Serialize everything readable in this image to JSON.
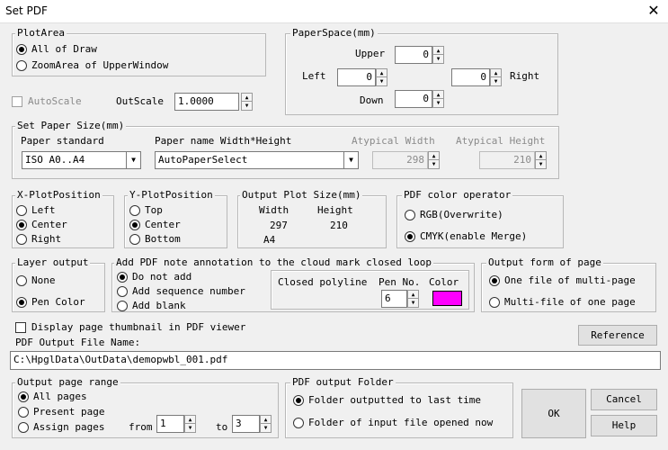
{
  "window": {
    "title": "Set PDF",
    "close_glyph": "✕"
  },
  "plot_area": {
    "legend": "PlotArea",
    "options": [
      "All of Draw",
      "ZoomArea of UpperWindow"
    ]
  },
  "paper_space": {
    "legend": "PaperSpace(mm)",
    "upper_label": "Upper",
    "upper_value": "0",
    "left_label": "Left",
    "left_value": "0",
    "right_label": "Right",
    "right_value": "0",
    "down_label": "Down",
    "down_value": "0"
  },
  "scale": {
    "autoscale_label": "AutoScale",
    "outscale_label": "OutScale",
    "outscale_value": "1.0000"
  },
  "paper_size": {
    "legend": "Set Paper Size(mm)",
    "standard_label": "Paper standard",
    "standard_value": "ISO A0..A4",
    "name_label": "Paper name Width*Height",
    "name_value": "AutoPaperSelect",
    "atypical_width_label": "Atypical Width",
    "atypical_width_value": "298",
    "atypical_height_label": "Atypical Height",
    "atypical_height_value": "210"
  },
  "x_plot": {
    "legend": "X-PlotPosition",
    "options": [
      "Left",
      "Center",
      "Right"
    ]
  },
  "y_plot": {
    "legend": "Y-PlotPosition",
    "options": [
      "Top",
      "Center",
      "Bottom"
    ]
  },
  "output_size": {
    "legend": "Output Plot Size(mm)",
    "width_label": "Width",
    "height_label": "Height",
    "width_value": "297",
    "height_value": "210",
    "paper": "A4"
  },
  "color_operator": {
    "legend": "PDF color operator",
    "options": [
      "RGB(Overwrite)",
      "CMYK(enable Merge)"
    ]
  },
  "layer_output": {
    "legend": "Layer output",
    "options": [
      "None",
      "Pen Color"
    ]
  },
  "annotation": {
    "legend": "Add PDF note annotation to the cloud mark closed loop",
    "options": [
      "Do not add",
      "Add sequence number",
      "Add blank"
    ],
    "closed_label": "Closed polyline",
    "pen_label": "Pen No.",
    "color_label": "Color",
    "pen_value": "6",
    "color_hex": "#ff00ff"
  },
  "output_form": {
    "legend": "Output form of page",
    "options": [
      "One file of multi-page",
      "Multi-file of one page"
    ]
  },
  "thumbnail_label": "Display page thumbnail in PDF viewer",
  "reference_button": "Reference",
  "file_name": {
    "label": "PDF Output File Name:",
    "value": "C:\\HpglData\\OutData\\demopwbl_001.pdf"
  },
  "page_range": {
    "legend": "Output page range",
    "options": [
      "All pages",
      "Present page",
      "Assign pages"
    ],
    "from_label": "from",
    "from_value": "1",
    "to_label": "to",
    "to_value": "3"
  },
  "output_folder": {
    "legend": "PDF output Folder",
    "options": [
      "Folder outputted to last time",
      "Folder of input file opened now"
    ]
  },
  "buttons": {
    "ok": "OK",
    "cancel": "Cancel",
    "help": "Help"
  }
}
